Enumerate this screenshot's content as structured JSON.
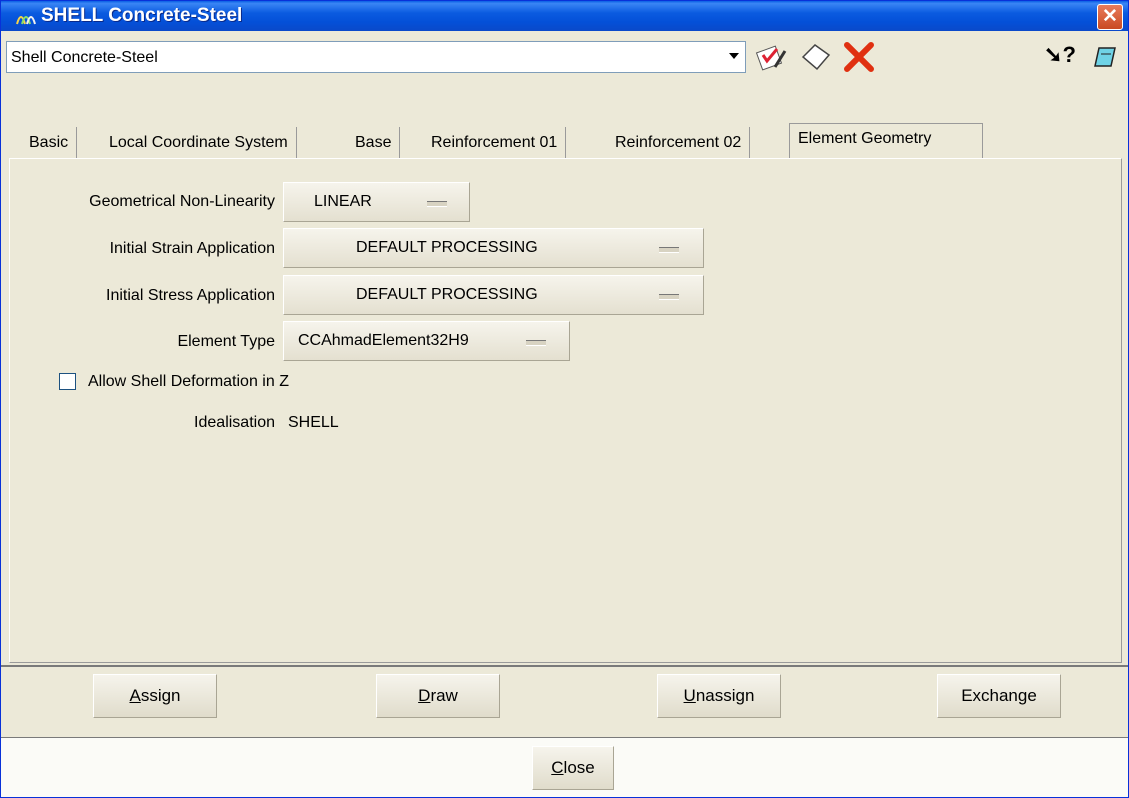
{
  "window": {
    "title": "SHELL Concrete-Steel"
  },
  "selector": {
    "value": "Shell Concrete-Steel"
  },
  "toolbar": {
    "help_label": "?"
  },
  "tabs": [
    "Basic",
    "Local Coordinate System",
    "Base",
    "Reinforcement 01",
    "Reinforcement 02",
    "Element Geometry"
  ],
  "form": {
    "geometrical_nonlinearity": {
      "label": "Geometrical Non-Linearity",
      "value": "LINEAR"
    },
    "initial_strain": {
      "label": "Initial Strain Application",
      "value": "DEFAULT PROCESSING"
    },
    "initial_stress": {
      "label": "Initial Stress Application",
      "value": "DEFAULT PROCESSING"
    },
    "element_type": {
      "label": "Element Type",
      "value": "CCAhmadElement32H9"
    },
    "allow_deformation": {
      "label": "Allow Shell Deformation in Z",
      "checked": false
    },
    "idealisation": {
      "label": "Idealisation",
      "value": "SHELL"
    }
  },
  "actions": {
    "assign_first": "A",
    "assign_rest": "ssign",
    "draw_first": "D",
    "draw_rest": "raw",
    "unassign_first": "U",
    "unassign_rest": "nassign",
    "exchange": "Exchange",
    "close_first": "C",
    "close_rest": "lose"
  }
}
